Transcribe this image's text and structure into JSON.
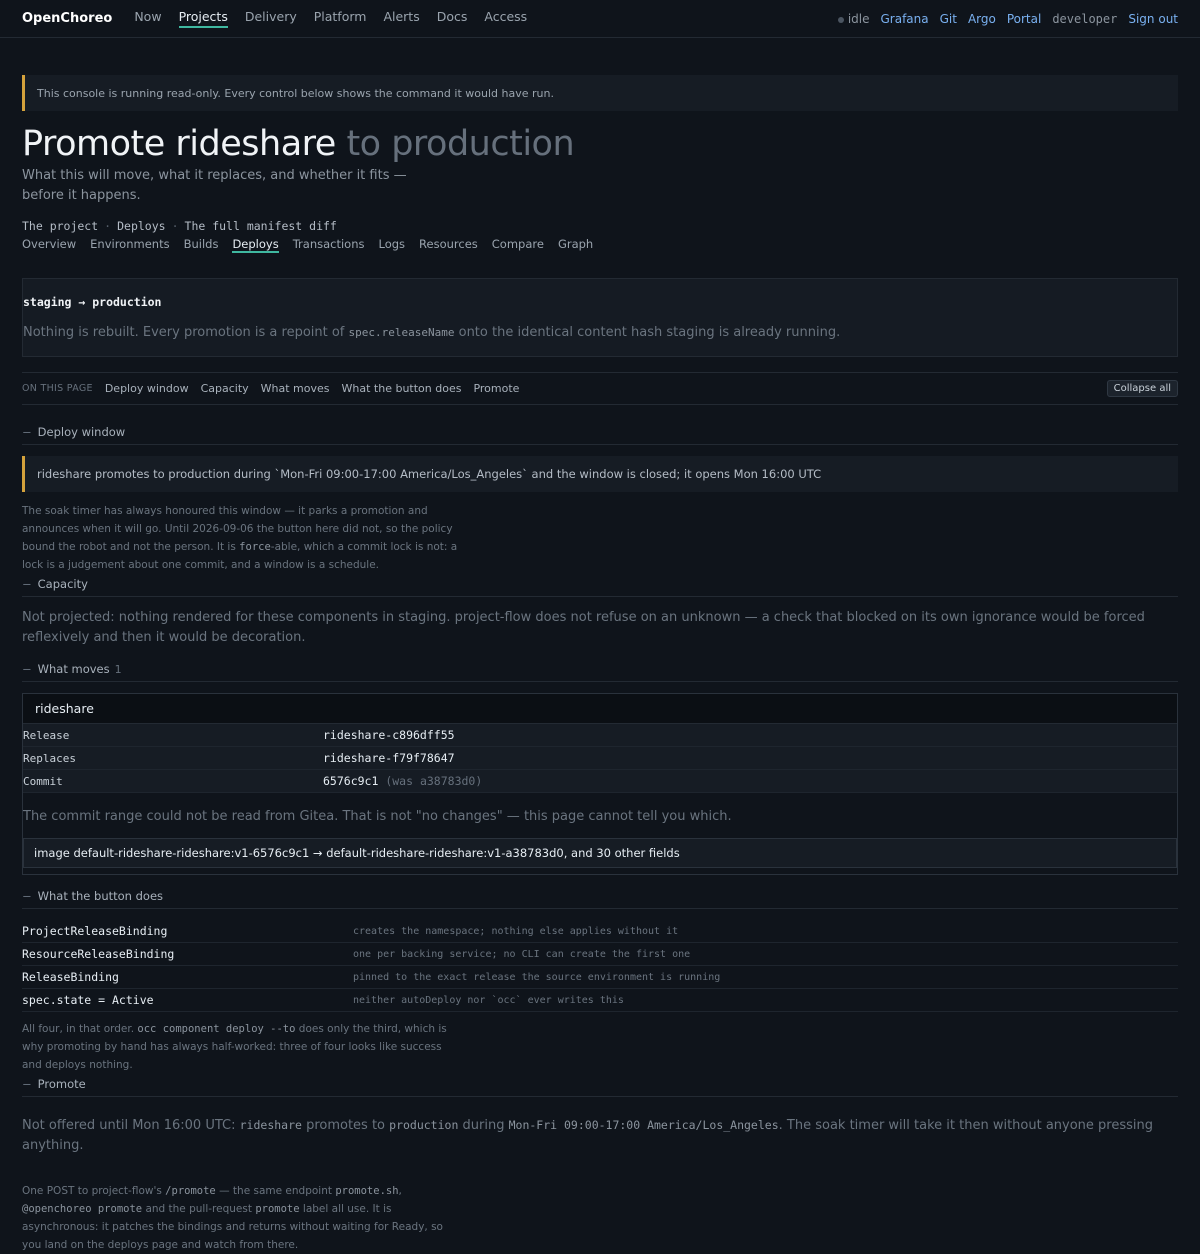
{
  "topbar": {
    "brand": "OpenChoreo",
    "nav": [
      "Now",
      "Projects",
      "Delivery",
      "Platform",
      "Alerts",
      "Docs",
      "Access"
    ],
    "active_nav": "Projects",
    "status": "idle",
    "links": [
      "Grafana",
      "Git",
      "Argo",
      "Portal"
    ],
    "user": "developer",
    "signout": "Sign out"
  },
  "banner": "This console is running read-only. Every control below shows the command it would have run.",
  "title": {
    "main": "Promote rideshare",
    "dim": " to production"
  },
  "subtitle": "What this will move, what it replaces, and whether it fits — before it happens.",
  "crumbs": [
    "The project",
    "Deploys",
    "The full manifest diff"
  ],
  "tabs": [
    "Overview",
    "Environments",
    "Builds",
    "Deploys",
    "Transactions",
    "Logs",
    "Resources",
    "Compare",
    "Graph"
  ],
  "active_tab": "Deploys",
  "promotion": {
    "route": "staging → production",
    "desc_before": "Nothing is rebuilt. Every promotion is a repoint of ",
    "desc_code": "spec.releaseName",
    "desc_after": " onto the identical content hash staging is already running."
  },
  "onpage": {
    "label": "ON THIS PAGE",
    "links": [
      "Deploy window",
      "Capacity",
      "What moves",
      "What the button does",
      "Promote"
    ],
    "collapse": "Collapse all"
  },
  "deploy_window": {
    "heading": "Deploy window",
    "notice": "rideshare promotes to production during `Mon-Fri 09:00-17:00 America/Los_Angeles` and the window is closed; it opens Mon 16:00 UTC",
    "note_before": "The soak timer has always honoured this window — it parks a promotion and announces when it will go. Until 2026-09-06 the button here did not, so the policy bound the robot and not the person. It is ",
    "note_code": "force",
    "note_after": "-able, which a commit lock is not: a lock is a judgement about one commit, and a window is a schedule."
  },
  "capacity": {
    "heading": "Capacity",
    "text": "Not projected: nothing rendered for these components in staging. project-flow does not refuse on an unknown — a check that blocked on its own ignorance would be forced reflexively and then it would be decoration."
  },
  "what_moves": {
    "heading": "What moves",
    "count": "1",
    "component": "rideshare",
    "rows": [
      {
        "k": "Release",
        "v": "rideshare-c896dff55"
      },
      {
        "k": "Replaces",
        "v": "rideshare-f79f78647"
      },
      {
        "k": "Commit",
        "v": "6576c9c1",
        "was": "(was a38783d0)"
      }
    ],
    "gitea_note": "The commit range could not be read from Gitea. That is not \"no changes\" — this page cannot tell you which.",
    "image_diff": "image default-rideshare-rideshare:v1-6576c9c1 → default-rideshare-rideshare:v1-a38783d0, and 30 other fields"
  },
  "button_does": {
    "heading": "What the button does",
    "rows": [
      {
        "k": "ProjectReleaseBinding",
        "v": "creates the namespace; nothing else applies without it"
      },
      {
        "k": "ResourceReleaseBinding",
        "v": "one per backing service; no CLI can create the first one"
      },
      {
        "k": "ReleaseBinding",
        "v": "pinned to the exact release the source environment is running"
      },
      {
        "k": "spec.state = Active",
        "v": "neither autoDeploy nor `occ` ever writes this"
      }
    ],
    "note_before": "All four, in that order. ",
    "note_code": "occ component deploy --to",
    "note_after": " does only the third, which is why promoting by hand has always half-worked: three of four looks like success and deploys nothing."
  },
  "promote": {
    "heading": "Promote",
    "t1": "Not offered until Mon 16:00 UTC: ",
    "c1": "rideshare",
    "t2": " promotes to ",
    "c2": "production",
    "t3": " during ",
    "c3": "Mon-Fri 09:00-17:00 America/Los_Angeles",
    "t4": ". The soak timer will take it then without anyone pressing anything.",
    "n1": "One POST to project-flow's ",
    "nc1": "/promote",
    "n2": " — the same endpoint ",
    "nc2": "promote.sh",
    "n3": ", ",
    "nc3": "@openchoreo promote",
    "n4": " and the pull-request ",
    "nc4": "promote",
    "n5": " label all use. It is asynchronous: it patches the bindings and returns without waiting for Ready, so you land on the deploys page and watch from there."
  }
}
